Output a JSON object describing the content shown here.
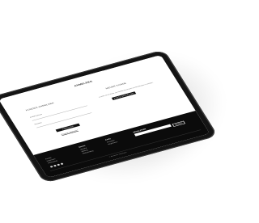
{
  "page": {
    "title": "ANMELDEN",
    "login": {
      "heading": "KUNDEN ANMELDEN",
      "email_label": "E-Mail-Adresse",
      "password_label": "Passwort",
      "submit_label": "ANMELDEN",
      "forgot_label": "Passwort vergessen?"
    },
    "register": {
      "heading": "NEUER KUNDE",
      "intro": "Erstellen Sie ein Konto, um schneller einzukaufen und Bestellungen zu verfolgen.",
      "button_label": "KONTO ERSTELLEN"
    }
  },
  "footer": {
    "col1": [
      "Kontakt",
      "Impressum",
      "Datenschutz"
    ],
    "col2_head": "Service",
    "col2": [
      "Versand",
      "Zahlung",
      "Rücksendung"
    ],
    "col3_head": "Konto",
    "col3": [
      "Anmelden",
      "Registrieren"
    ],
    "newsletter_head": "NEWSLETTER",
    "newsletter_button": "SENDEN",
    "social_icons": [
      "facebook-icon",
      "instagram-icon",
      "pinterest-icon",
      "youtube-icon"
    ],
    "copyright": "© Alle Rechte vorbehalten"
  }
}
